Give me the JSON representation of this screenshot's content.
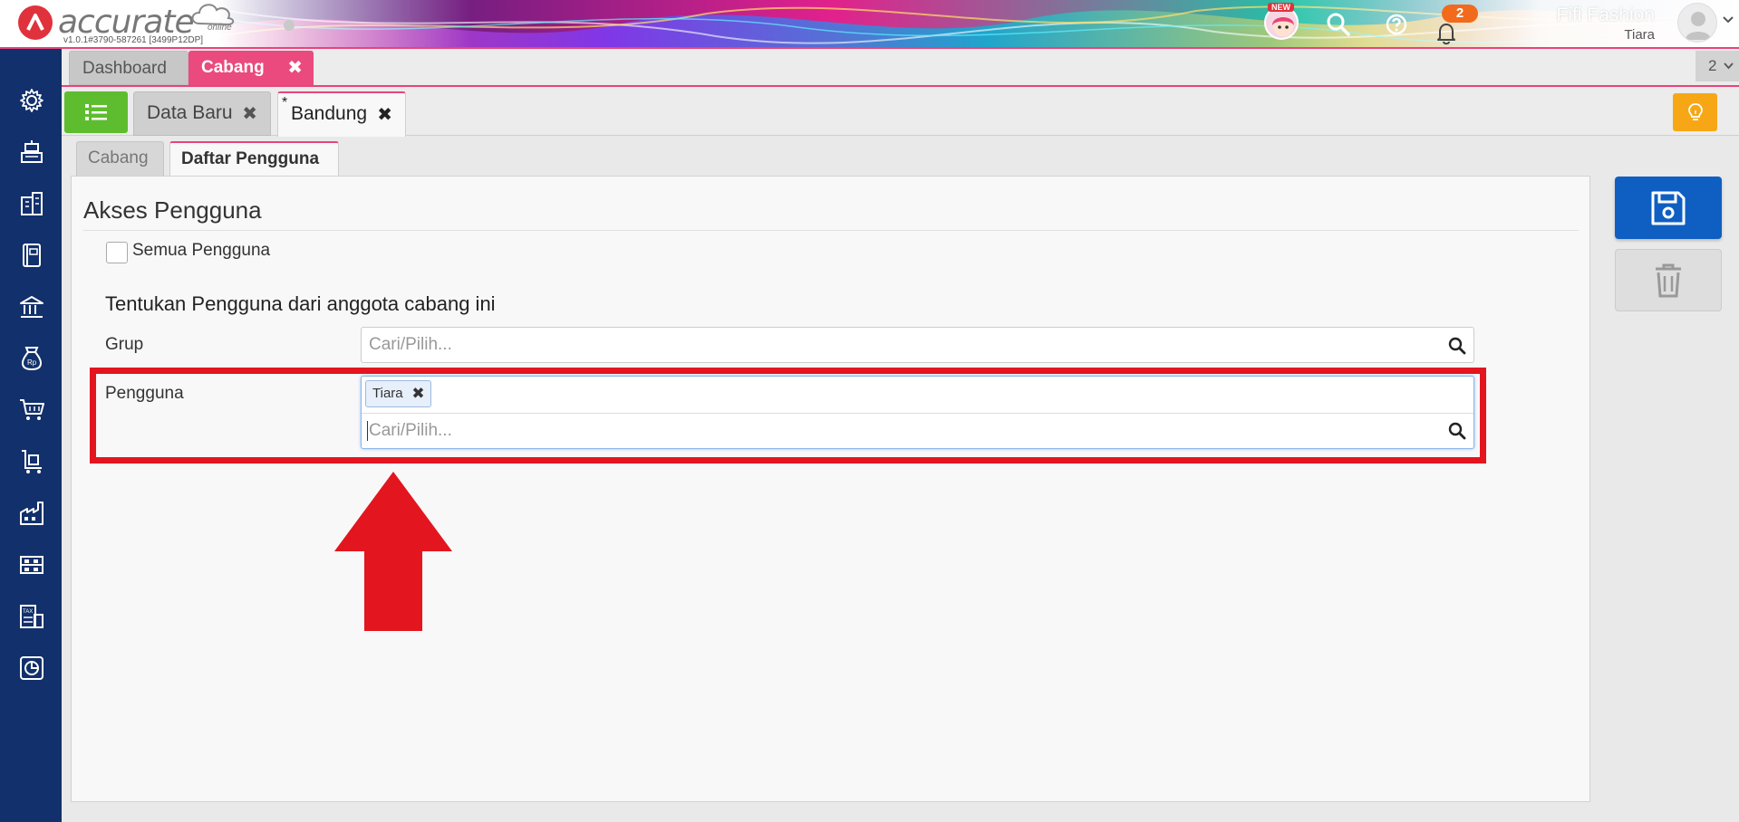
{
  "app": {
    "logo_text": "accurate",
    "logo_sub": "online",
    "version": "v1.0.1#3790-587261 [3499P12DP]"
  },
  "topbar": {
    "new_badge": "NEW",
    "notification_count": "2",
    "company": "Fifi Fashion",
    "user": "Tiara",
    "icons": [
      "search-icon",
      "help-icon",
      "bell-icon"
    ]
  },
  "sidebar": {
    "items": [
      "settings-icon",
      "cash-register-icon",
      "company-icon",
      "ledger-book-icon",
      "bank-icon",
      "money-bag-icon",
      "shopping-cart-icon",
      "delivery-cart-icon",
      "factory-icon",
      "inventory-icon",
      "tax-icon",
      "report-chart-icon"
    ]
  },
  "tabs_top": {
    "dashboard": "Dashboard",
    "cabang": "Cabang",
    "close": "✖",
    "count": "2"
  },
  "tabs_doc": {
    "data_baru": "Data Baru",
    "bandung": "Bandung",
    "bandung_modified": "*",
    "close": "✖"
  },
  "subtabs": {
    "cabang": "Cabang",
    "daftar_pengguna": "Daftar Pengguna"
  },
  "form": {
    "section_title": "Akses Pengguna",
    "all_users_label": "Semua Pengguna",
    "all_users_checked": false,
    "subheading": "Tentukan Pengguna dari anggota cabang ini",
    "group_label": "Grup",
    "group_placeholder": "Cari/Pilih...",
    "user_label": "Pengguna",
    "user_chips": [
      "Tiara"
    ],
    "chip_remove": "✖",
    "user_placeholder": "Cari/Pilih..."
  },
  "colors": {
    "sidebar": "#12306b",
    "accent_pink": "#e8437a",
    "list_green": "#5ebd2f",
    "save_blue": "#0f5fc2",
    "annotation_red": "#e3151f",
    "bulb_orange": "#f7a716"
  }
}
